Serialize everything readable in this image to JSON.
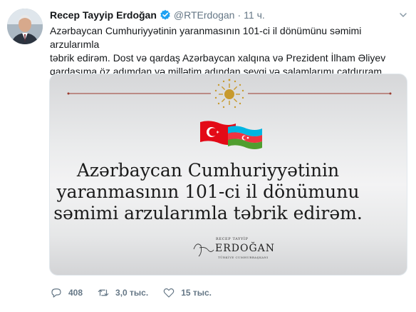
{
  "tweet": {
    "author_name": "Recep Tayyip Erdoğan",
    "handle": "@RTErdogan",
    "separator": "·",
    "time": "11 ч.",
    "text_line1": "Azərbaycan Cumhuriyyətinin yaranmasının 101-ci il dönümünu səmimi arzularımla",
    "text_line2": "təbrik edirəm. Dost və qardaş Azərbaycan xalqına və Prezident İlham Əliyev",
    "text_line3": "qardaşıma öz adımdan və millətim adından sevgi və salamlarımı çatdırıram."
  },
  "card": {
    "title_line1": "Azərbaycan Cumhuriyyətinin",
    "title_line2": "yaranmasının 101-ci il dönümunu",
    "title_line3": "səmimi arzularımla təbrik edirəm.",
    "signature_top": "RECEP TAYYİP",
    "signature_name": "ERDOĞAN",
    "signature_sub": "TÜRKİYE CUMHURBAŞKANI"
  },
  "actions": {
    "reply_count": "408",
    "retweet_count": "3,0 тыс.",
    "like_count": "15 тыс."
  },
  "colors": {
    "verified": "#1da1f2",
    "secondary_text": "#657786",
    "gold": "#b8922a",
    "turkey_red": "#e30a17",
    "azerbaijan_blue": "#00b5e2",
    "azerbaijan_red": "#ef3340",
    "azerbaijan_green": "#509e2f"
  }
}
